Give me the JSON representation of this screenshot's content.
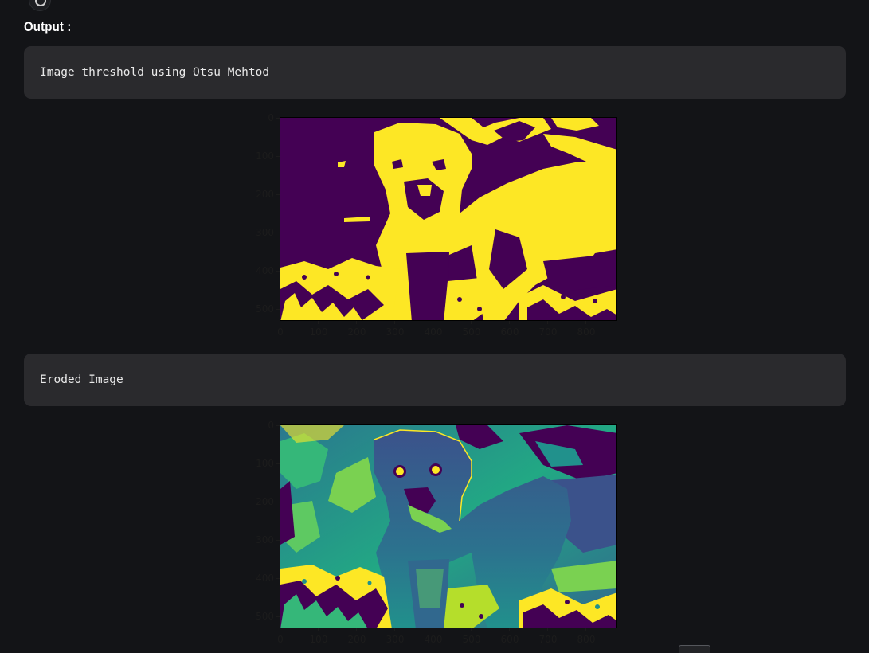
{
  "output": {
    "label": "Output :"
  },
  "blocks": [
    {
      "text": "Image threshold using Otsu Mehtod",
      "plot": {
        "colormap": "viridis",
        "image_kind": "binary threshold",
        "xticks": [
          "0",
          "100",
          "200",
          "300",
          "400",
          "500",
          "600",
          "700",
          "800"
        ],
        "yticks": [
          "0",
          "100",
          "200",
          "300",
          "400",
          "500"
        ],
        "colors": {
          "low": "#440154",
          "high": "#fde725"
        }
      }
    },
    {
      "text": "Eroded Image",
      "plot": {
        "colormap": "viridis",
        "image_kind": "eroded grayscale",
        "xticks": [
          "0",
          "100",
          "200",
          "300",
          "400",
          "500",
          "600",
          "700",
          "800"
        ],
        "yticks": [
          "0",
          "100",
          "200",
          "300",
          "400",
          "500"
        ],
        "colors": {
          "low": "#440154",
          "mid": "#21918c",
          "high": "#fde725"
        }
      }
    }
  ],
  "icons": {
    "top": "cell-run-icon",
    "bottom": "scroll-to-top-button"
  }
}
